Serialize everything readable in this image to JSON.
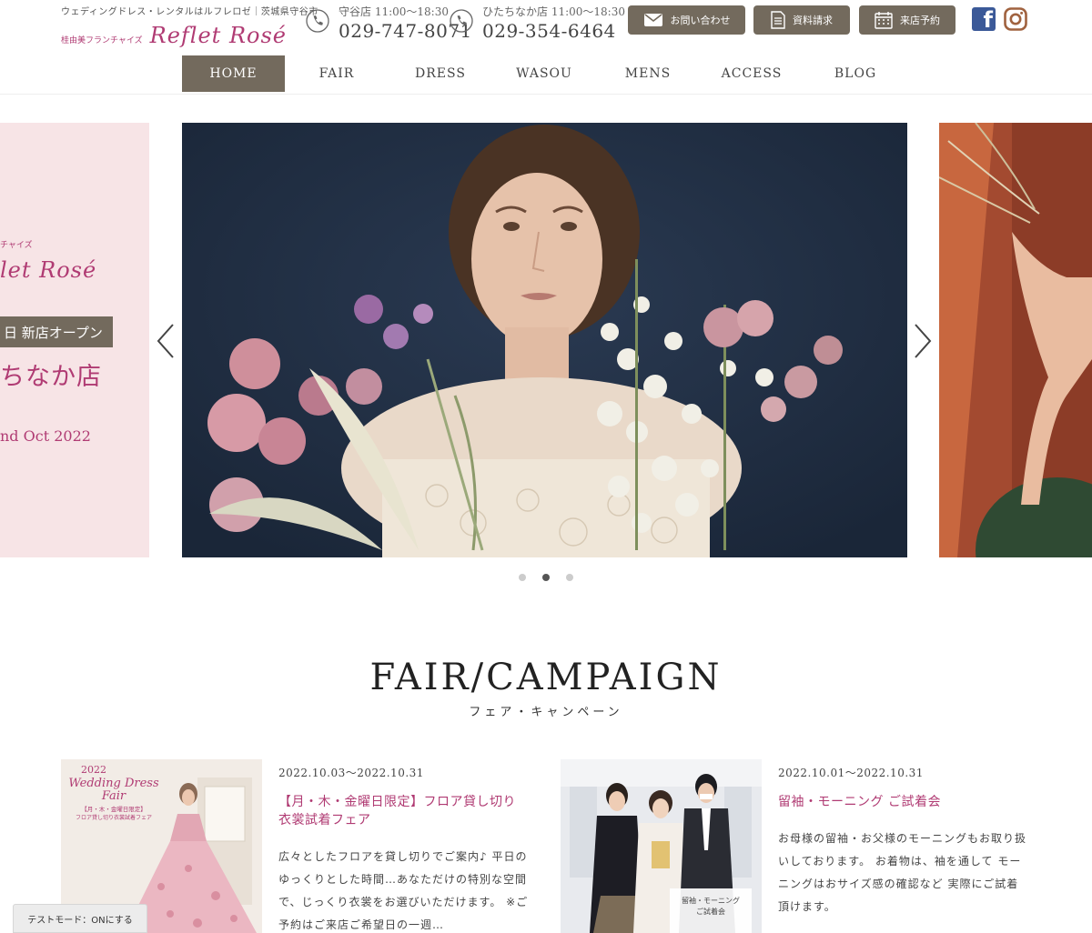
{
  "header": {
    "tagline": "ウェディングドレス・レンタルはルフレロゼ｜茨城県守谷市",
    "franchise": "桂由美フランチャイズ",
    "logo": "Reflet Rosé",
    "phones": [
      {
        "label": "守谷店 11:00〜18:30",
        "number": "029-747-8071"
      },
      {
        "label": "ひたちなか店 11:00〜18:30",
        "number": "029-354-6464"
      }
    ],
    "buttons": {
      "contact": "お問い合わせ",
      "docs": "資料請求",
      "visit": "来店予約"
    },
    "colors": {
      "brand": "#b03b73",
      "accent": "#736a5d"
    }
  },
  "nav": {
    "items": [
      "HOME",
      "FAIR",
      "DRESS",
      "WASOU",
      "MENS",
      "ACCESS",
      "BLOG"
    ],
    "active": "HOME"
  },
  "slider": {
    "left_slide": {
      "franchise": "チャイズ",
      "logo": "let Rosé",
      "badge": "日 新店オープン",
      "store": "ちなか店",
      "date": "nd Oct 2022"
    },
    "dots": 3,
    "active_dot": 2
  },
  "section": {
    "title": "FAIR/CAMPAIGN",
    "subtitle": "フェア・キャンペーン"
  },
  "campaigns": [
    {
      "date": "2022.10.03〜2022.10.31",
      "title_line1": "【月・木・金曜日限定】フロア貸し切り",
      "title_line2": "衣裳試着フェア",
      "text": "広々としたフロアを貸し切りでご案内♪ 平日のゆっくりとした時間…あなただけの特別な空間で、じっくり衣裳をお選びいただけます。 ※ご予約はご来店ご希望日の一週…",
      "image_caption_1": "2022",
      "image_caption_2": "Wedding Dress",
      "image_caption_3": "Fair",
      "image_caption_4": "【月・木・金曜日限定】",
      "image_caption_5": "フロア貸し切り衣裳試着フェア"
    },
    {
      "date": "2022.10.01〜2022.10.31",
      "title_line1": "留袖・モーニング ご試着会",
      "title_line2": "",
      "text": "お母様の留袖・お父様のモーニングもお取り扱いしております。 お着物は、袖を通して モーニングはおサイズ感の確認など 実際にご試着頂けます。",
      "image_caption_1": "留袖・モーニング",
      "image_caption_2": "ご試着会"
    }
  ],
  "test_mode": "テストモード：ONにする"
}
